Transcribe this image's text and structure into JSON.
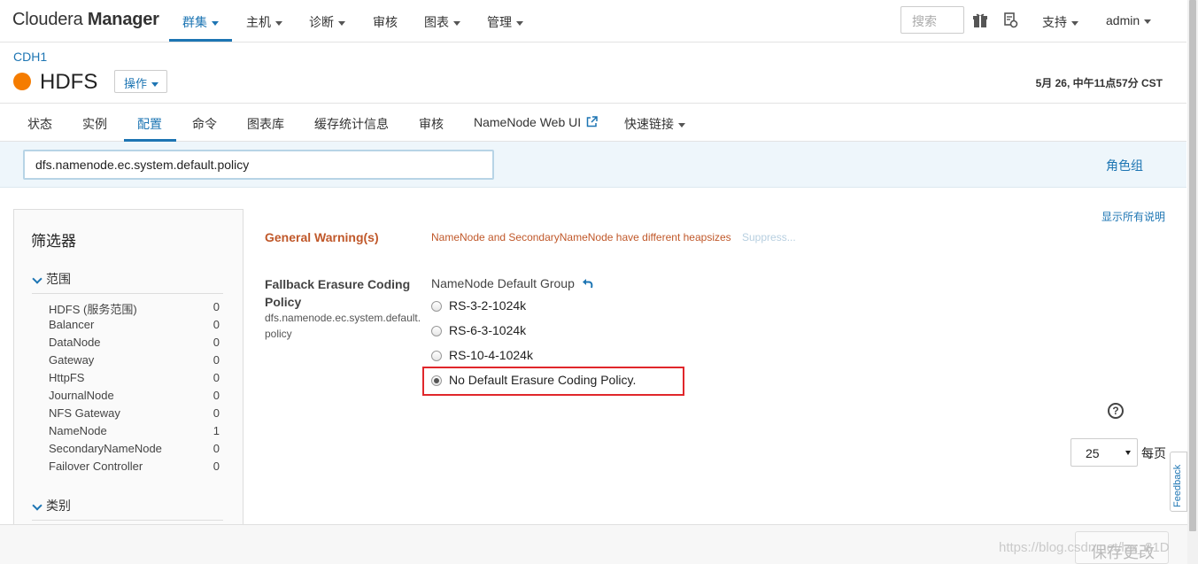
{
  "app": {
    "brand_light": "Cloudera ",
    "brand_bold": "Manager"
  },
  "nav": {
    "items": [
      {
        "label": "群集",
        "active": true
      },
      {
        "label": "主机"
      },
      {
        "label": "诊断"
      },
      {
        "label": "审核"
      },
      {
        "label": "图表"
      },
      {
        "label": "管理"
      }
    ],
    "search_placeholder": "搜索",
    "support_label": "支持",
    "user_label": "admin"
  },
  "header": {
    "breadcrumb": "CDH1",
    "service_name": "HDFS",
    "status_color": "#f57c00",
    "actions_label": "操作",
    "timestamp": "5月 26, 中午11点57分 CST"
  },
  "tabs": [
    {
      "label": "状态"
    },
    {
      "label": "实例"
    },
    {
      "label": "配置",
      "active": true
    },
    {
      "label": "命令"
    },
    {
      "label": "图表库"
    },
    {
      "label": "缓存统计信息"
    },
    {
      "label": "审核"
    },
    {
      "label": "NameNode Web UI"
    },
    {
      "label": "快速链接"
    }
  ],
  "filter_bar": {
    "search_value": "dfs.namenode.ec.system.default.policy",
    "role_groups_link": "角色组"
  },
  "sidebar": {
    "title": "筛选器",
    "scope_heading": "范围",
    "scope_items": [
      {
        "label": "HDFS (服务范围)",
        "count": "0"
      },
      {
        "label": "Balancer",
        "count": "0"
      },
      {
        "label": "DataNode",
        "count": "0"
      },
      {
        "label": "Gateway",
        "count": "0"
      },
      {
        "label": "HttpFS",
        "count": "0"
      },
      {
        "label": "JournalNode",
        "count": "0"
      },
      {
        "label": "NFS Gateway",
        "count": "0"
      },
      {
        "label": "NameNode",
        "count": "1"
      },
      {
        "label": "SecondaryNameNode",
        "count": "0"
      },
      {
        "label": "Failover Controller",
        "count": "0"
      }
    ],
    "category_heading": "类别"
  },
  "main": {
    "show_all_desc": "显示所有说明",
    "general_warning_label": "General Warning(s)",
    "general_warning_msg": "NameNode and SecondaryNameNode have different heapsizes",
    "suppress_label": "Suppress...",
    "property": {
      "label": "Fallback Erasure Coding Policy",
      "key": "dfs.namenode.ec.system.default.policy",
      "group": "NameNode Default Group",
      "options": [
        {
          "label": "RS-3-2-1024k",
          "checked": false
        },
        {
          "label": "RS-6-3-1024k",
          "checked": false
        },
        {
          "label": "RS-10-4-1024k",
          "checked": false
        },
        {
          "label": "No Default Erasure Coding Policy.",
          "checked": true
        }
      ]
    },
    "per_page_value": "25",
    "per_page_label": "每页"
  },
  "feedback_label": "Feedback",
  "footer": {
    "save_label": "保存更改",
    "watermark": "https://blog.csdn.net/lzx_81D"
  }
}
